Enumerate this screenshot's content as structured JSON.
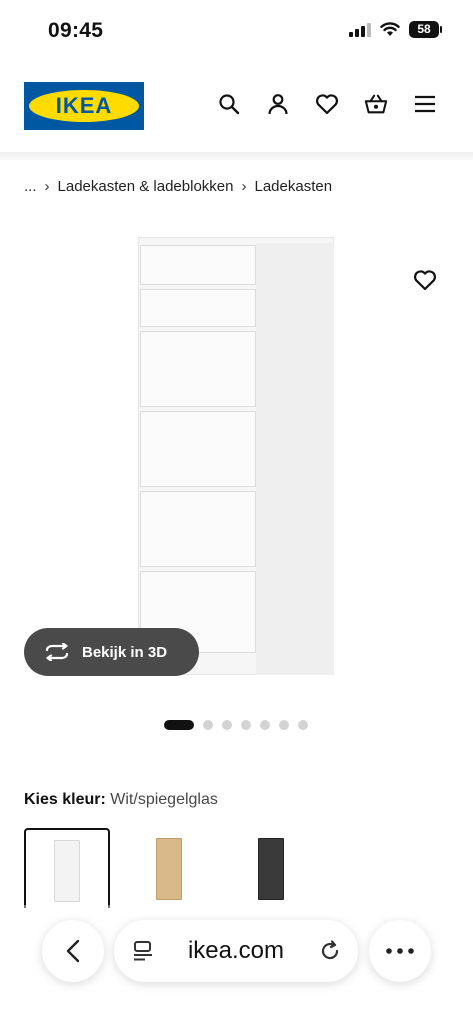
{
  "status_bar": {
    "time": "09:45",
    "battery": "58"
  },
  "header": {
    "logo_text": "IKEA"
  },
  "breadcrumb": {
    "items": [
      "...",
      "Ladekasten & ladeblokken",
      "Ladekasten"
    ]
  },
  "product": {
    "view_3d_label": "Bekijk in 3D"
  },
  "carousel": {
    "total": 7,
    "active_index": 0
  },
  "color": {
    "label": "Kies kleur:",
    "value": "Wit/spiegelglas",
    "swatches": [
      {
        "name": "wit",
        "color": "#f3f3f3",
        "selected": true
      },
      {
        "name": "eiken",
        "color": "#d9b88a",
        "selected": false
      },
      {
        "name": "zwartbruin",
        "color": "#3a3a3a",
        "selected": false
      }
    ]
  },
  "browser": {
    "url": "ikea.com"
  },
  "colors": {
    "ikea_blue": "#0058a3",
    "ikea_yellow": "#ffdb00",
    "button_dark": "#4a4a4a"
  }
}
